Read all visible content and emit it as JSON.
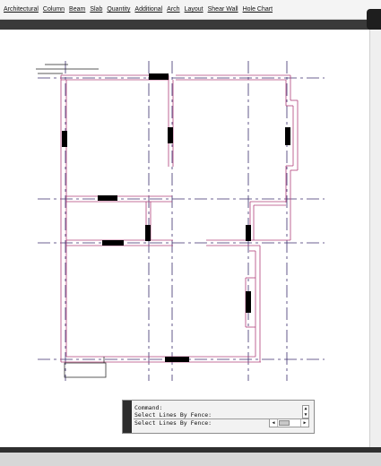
{
  "menu": {
    "items": [
      "Architectural",
      "Column",
      "Beam",
      "Slab",
      "Quantity",
      "Additional",
      "Arch",
      "Layout",
      "Shear Wall",
      "Hole Chart"
    ]
  },
  "command_window": {
    "lines": [
      "Command:",
      "Select Lines By Fence:",
      "Select Lines By Fence:"
    ]
  },
  "colors": {
    "wall_line": "#b0407a",
    "grid_line": "#3c2f6e",
    "column_fill": "#000000",
    "toolbar_dark": "#3a3a3a"
  },
  "icons": {
    "scroll_up": "▲",
    "scroll_down": "▼",
    "scroll_left": "◀",
    "scroll_right": "▶"
  }
}
